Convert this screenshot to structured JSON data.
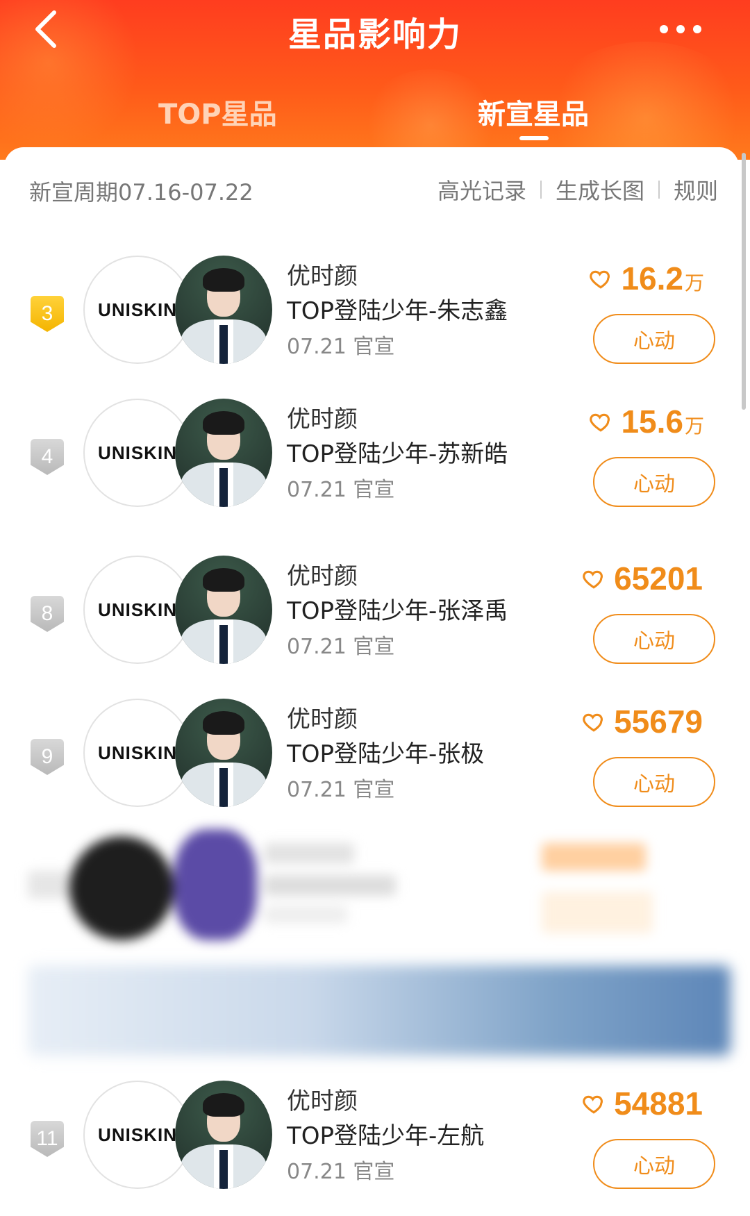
{
  "header": {
    "title": "星品影响力",
    "tabs": [
      "TOP星品",
      "新宣星品"
    ],
    "active_tab": "新宣星品"
  },
  "toolbar": {
    "period": "新宣周期07.16-07.22",
    "links": [
      "高光记录",
      "生成长图",
      "规则"
    ]
  },
  "items": [
    {
      "rank": "3",
      "rank_style": "gold",
      "logo": "UNISKIN",
      "brand": "优时颜",
      "product": "TOP登陆少年-朱志鑫",
      "release": "07.21 官宣",
      "likes_num": "16.2",
      "likes_unit": "万",
      "button": "心动"
    },
    {
      "rank": "4",
      "rank_style": "silver",
      "logo": "UNISKIN",
      "brand": "优时颜",
      "product": "TOP登陆少年-苏新皓",
      "release": "07.21 官宣",
      "likes_num": "15.6",
      "likes_unit": "万",
      "button": "心动"
    },
    {
      "rank": "8",
      "rank_style": "silver",
      "logo": "UNISKIN",
      "brand": "优时颜",
      "product": "TOP登陆少年-张泽禹",
      "release": "07.21 官宣",
      "likes_num": "65201",
      "likes_unit": "",
      "button": "心动"
    },
    {
      "rank": "9",
      "rank_style": "silver",
      "logo": "UNISKIN",
      "brand": "优时颜",
      "product": "TOP登陆少年-张极",
      "release": "07.21 官宣",
      "likes_num": "55679",
      "likes_unit": "",
      "button": "心动"
    },
    {
      "rank": "11",
      "rank_style": "silver",
      "logo": "UNISKIN",
      "brand": "优时颜",
      "product": "TOP登陆少年-左航",
      "release": "07.21 官宣",
      "likes_num": "54881",
      "likes_unit": "",
      "button": "心动"
    }
  ],
  "colors": {
    "header_start": "#ff3d1f",
    "header_end": "#ff7a1c",
    "accent": "#f08c1a",
    "rank_gold": "#f4b400",
    "rank_silver": "#b9b9b9"
  },
  "icons": {
    "back": "chevron-left-icon",
    "more": "more-dots-icon",
    "like": "heart-outline-icon"
  }
}
